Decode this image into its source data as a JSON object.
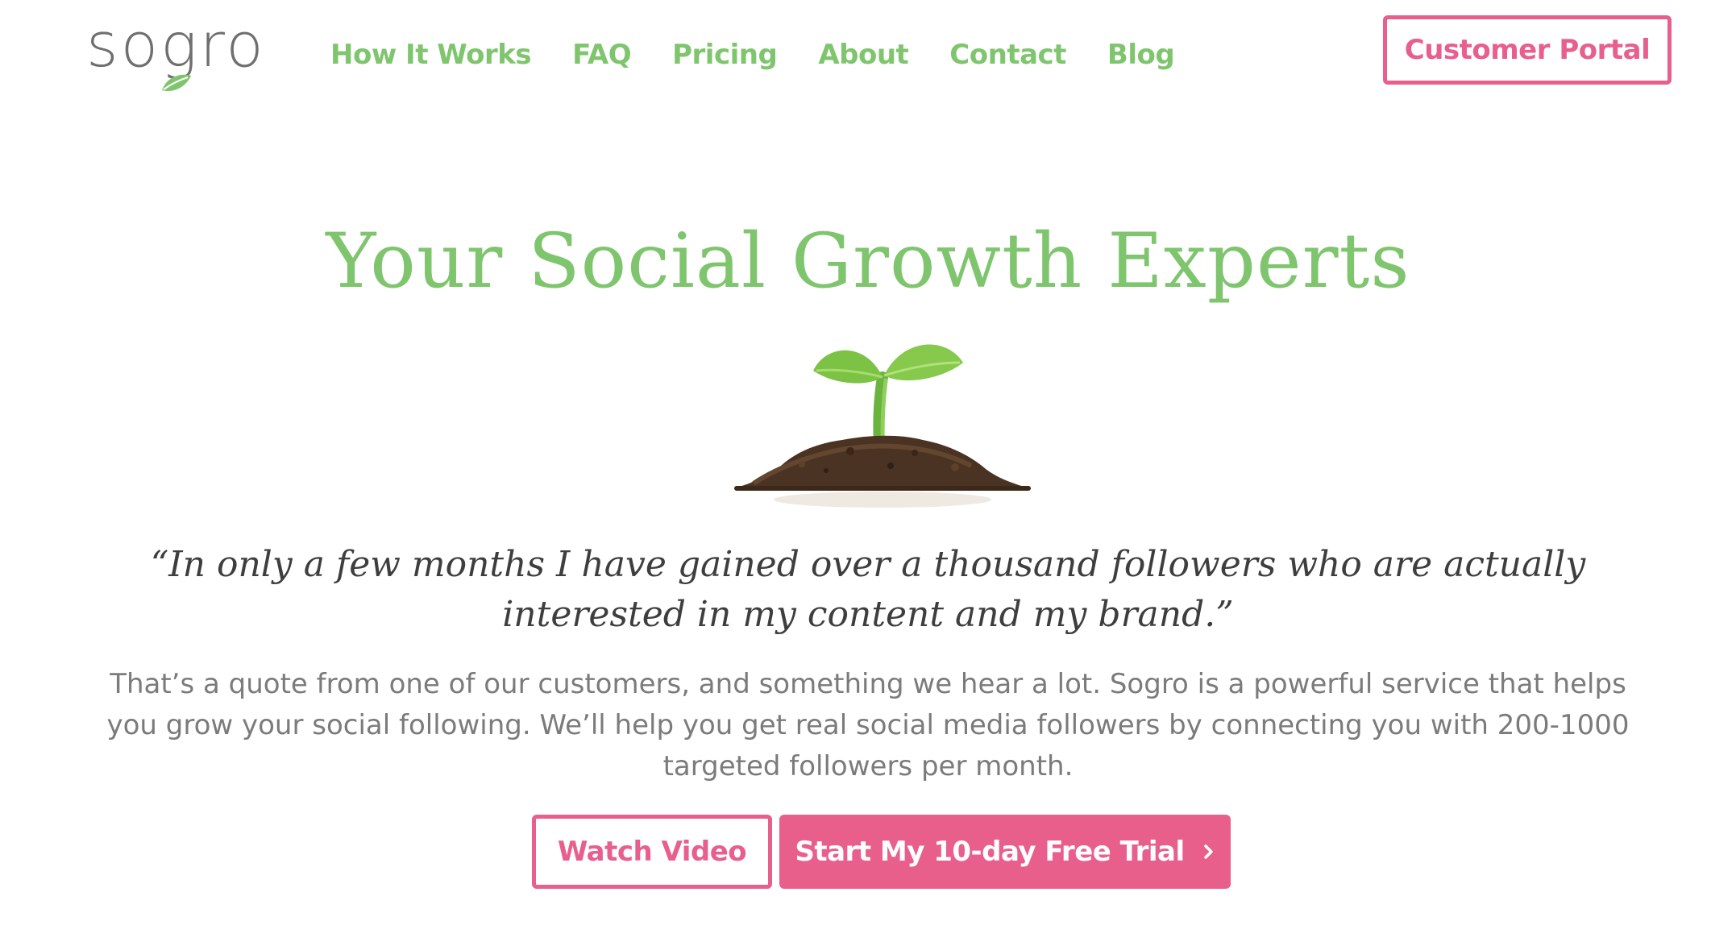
{
  "header": {
    "logo_text": "sogro",
    "nav": [
      {
        "label": "How It Works"
      },
      {
        "label": "FAQ"
      },
      {
        "label": "Pricing"
      },
      {
        "label": "About"
      },
      {
        "label": "Contact"
      },
      {
        "label": "Blog"
      }
    ],
    "portal_label": "Customer Portal"
  },
  "hero": {
    "title": "Your Social Growth Experts",
    "quote": "“In only a few months I have gained over a thousand followers who are actually interested in my content and my brand.”",
    "description": "That’s a quote from one of our customers, and something we hear a lot. Sogro is a powerful service that helps you grow your social following. We’ll help you get real social media followers by connecting you with 200-1000 targeted followers per month.",
    "watch_label": "Watch Video",
    "trial_label": "Start My 10-day Free Trial"
  },
  "icons": {
    "logo_leaf": "leaf-icon",
    "hero_illustration": "sprout-icon",
    "trial_arrow": "chevron-right-icon"
  },
  "colors": {
    "brand_green": "#7fc56e",
    "accent_pink": "#e85f8c",
    "logo_gray": "#6f6f6f",
    "body_text": "#7b7b7b",
    "quote_text": "#3e3e3e"
  }
}
